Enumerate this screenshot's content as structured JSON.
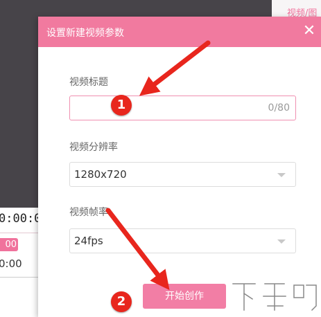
{
  "background": {
    "right_panel_link": "视频/图",
    "timecode": "0:00:0",
    "badge": "00",
    "time_label": "0:00"
  },
  "dialog": {
    "title": "设置新建视频参数",
    "close_icon": "close-icon",
    "title_field": {
      "label": "视频标题",
      "value": "",
      "counter": "0/80"
    },
    "resolution_field": {
      "label": "视频分辨率",
      "selected": "1280x720"
    },
    "framerate_field": {
      "label": "视频帧率",
      "selected": "24fps"
    },
    "create_button": "开始创作"
  },
  "annotations": {
    "marker_1": "1",
    "marker_2": "2",
    "arrow_color": "#e8261d"
  },
  "watermark": {
    "text": "下载吧"
  },
  "colors": {
    "accent": "#f17a9f",
    "marker": "#e8261d"
  }
}
